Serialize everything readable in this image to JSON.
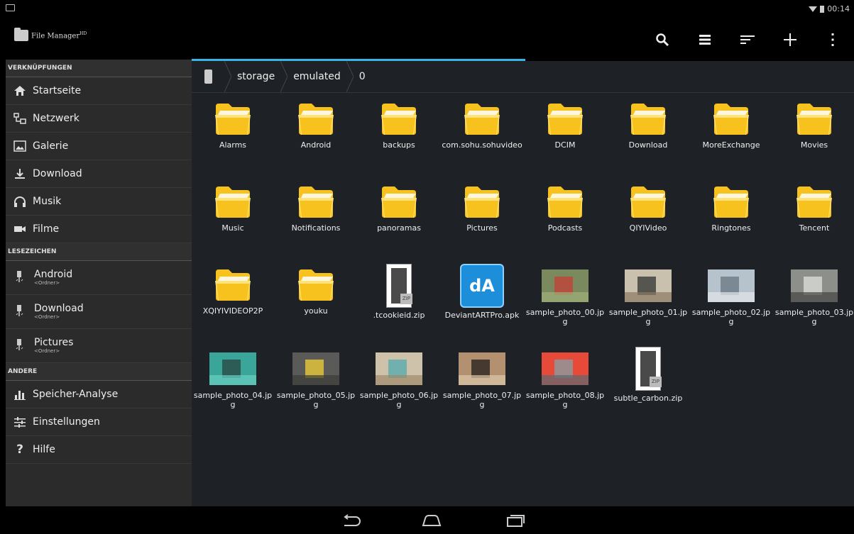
{
  "status": {
    "time": "00:14"
  },
  "app": {
    "title": "File Manager",
    "title_sup": "HD"
  },
  "sidebar": {
    "sections": {
      "shortcuts": "VERKNÜPFUNGEN",
      "bookmarks": "LESEZEICHEN",
      "other": "ANDERE"
    },
    "shortcuts": [
      {
        "label": "Startseite",
        "icon": "home-icon"
      },
      {
        "label": "Netzwerk",
        "icon": "network-icon"
      },
      {
        "label": "Galerie",
        "icon": "gallery-icon"
      },
      {
        "label": "Download",
        "icon": "download-icon"
      },
      {
        "label": "Musik",
        "icon": "headphones-icon"
      },
      {
        "label": "Filme",
        "icon": "video-camera-icon"
      }
    ],
    "bookmarks": [
      {
        "label": "Android",
        "sub": "<Ordner>"
      },
      {
        "label": "Download",
        "sub": "<Ordner>"
      },
      {
        "label": "Pictures",
        "sub": "<Ordner>"
      }
    ],
    "other": [
      {
        "label": "Speicher-Analyse",
        "icon": "chart-icon"
      },
      {
        "label": "Einstellungen",
        "icon": "sliders-icon"
      },
      {
        "label": "Hilfe",
        "icon": "help-icon"
      }
    ]
  },
  "breadcrumb": [
    "storage",
    "emulated",
    "0"
  ],
  "files": [
    {
      "name": "Alarms",
      "type": "folder"
    },
    {
      "name": "Android",
      "type": "folder"
    },
    {
      "name": "backups",
      "type": "folder"
    },
    {
      "name": "com.sohu.sohuvideo",
      "type": "folder"
    },
    {
      "name": "DCIM",
      "type": "folder"
    },
    {
      "name": "Download",
      "type": "folder"
    },
    {
      "name": "MoreExchange",
      "type": "folder"
    },
    {
      "name": "Movies",
      "type": "folder"
    },
    {
      "name": "Music",
      "type": "folder"
    },
    {
      "name": "Notifications",
      "type": "folder"
    },
    {
      "name": "panoramas",
      "type": "folder"
    },
    {
      "name": "Pictures",
      "type": "folder"
    },
    {
      "name": "Podcasts",
      "type": "folder"
    },
    {
      "name": "QIYIVideo",
      "type": "folder"
    },
    {
      "name": "Ringtones",
      "type": "folder"
    },
    {
      "name": "Tencent",
      "type": "folder"
    },
    {
      "name": "XQIYIVIDEOP2P",
      "type": "folder"
    },
    {
      "name": "youku",
      "type": "folder"
    },
    {
      "name": ".tcookieid.zip",
      "type": "zip"
    },
    {
      "name": "DeviantARTPro.apk",
      "type": "apk"
    },
    {
      "name": "sample_photo_00.jpg",
      "type": "image",
      "colors": [
        "#7a8a5e",
        "#c2423a",
        "#9fb07a"
      ]
    },
    {
      "name": "sample_photo_01.jpg",
      "type": "image",
      "colors": [
        "#c9c0ae",
        "#3a3a38",
        "#8a7a62"
      ]
    },
    {
      "name": "sample_photo_02.jpg",
      "type": "image",
      "colors": [
        "#b6c2cc",
        "#6c7a84",
        "#e2e6ea"
      ]
    },
    {
      "name": "sample_photo_03.jpg",
      "type": "image",
      "colors": [
        "#8c8f8a",
        "#d9dbd6",
        "#444"
      ]
    },
    {
      "name": "sample_photo_04.jpg",
      "type": "image",
      "colors": [
        "#3aa69a",
        "#2a4a46",
        "#6ad0c0"
      ]
    },
    {
      "name": "sample_photo_05.jpg",
      "type": "image",
      "colors": [
        "#5a5a58",
        "#e8c83a",
        "#3a3a38"
      ]
    },
    {
      "name": "sample_photo_06.jpg",
      "type": "image",
      "colors": [
        "#cfc2aa",
        "#5aaab0",
        "#a08a6a"
      ]
    },
    {
      "name": "sample_photo_07.jpg",
      "type": "image",
      "colors": [
        "#b29070",
        "#2a2420",
        "#dcc8a8"
      ]
    },
    {
      "name": "sample_photo_08.jpg",
      "type": "image",
      "colors": [
        "#e84a3a",
        "#8a9aa0",
        "#5a6a70"
      ]
    },
    {
      "name": "subtle_carbon.zip",
      "type": "zip"
    }
  ],
  "colors": {
    "accent": "#33b5e5",
    "folder": "#f7c21e",
    "folder_light": "#ffe27a"
  }
}
